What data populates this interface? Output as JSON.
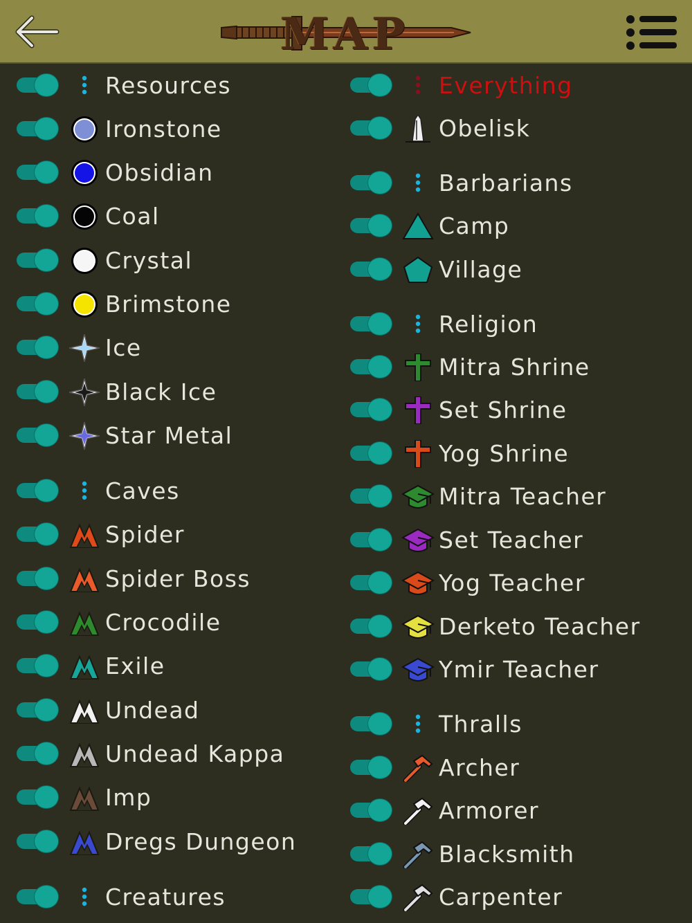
{
  "header": {
    "title": "MAP",
    "back": "back-arrow-icon",
    "menu": "menu-list-icon"
  },
  "colors": {
    "header": "#8e8a45",
    "background": "#2d2d20",
    "toggle": "#13a596",
    "text": "#e6e6dc",
    "highlight": "#cc1010"
  },
  "left": [
    {
      "label": "Resources",
      "icon": "dots"
    },
    {
      "label": "Ironstone",
      "icon": "circle",
      "color": "#7f8fd6"
    },
    {
      "label": "Obsidian",
      "icon": "circle",
      "color": "#1414e6"
    },
    {
      "label": "Coal",
      "icon": "circle",
      "color": "#050505"
    },
    {
      "label": "Crystal",
      "icon": "circle",
      "color": "#f6f6f6"
    },
    {
      "label": "Brimstone",
      "icon": "circle",
      "color": "#f4e400"
    },
    {
      "label": "Ice",
      "icon": "star",
      "color": "#a8d8f8"
    },
    {
      "label": "Black Ice",
      "icon": "star",
      "color": "#1a1a1a"
    },
    {
      "label": "Star Metal",
      "icon": "star",
      "color": "#6a6ae0"
    },
    {
      "label": "Caves",
      "icon": "dots"
    },
    {
      "label": "Spider",
      "icon": "cave",
      "color": "#e04a1a"
    },
    {
      "label": "Spider Boss",
      "icon": "cave",
      "color": "#ea5a2a"
    },
    {
      "label": "Crocodile",
      "icon": "cave",
      "color": "#2e8a2e"
    },
    {
      "label": "Exile",
      "icon": "cave",
      "color": "#16a69a"
    },
    {
      "label": "Undead",
      "icon": "cave",
      "color": "#f2f2f2"
    },
    {
      "label": "Undead Kappa",
      "icon": "cave",
      "color": "#b8b8b8"
    },
    {
      "label": "Imp",
      "icon": "cave",
      "color": "#6a4a38"
    },
    {
      "label": "Dregs Dungeon",
      "icon": "cave",
      "color": "#3a4ad0"
    },
    {
      "label": "Creatures",
      "icon": "dots"
    }
  ],
  "right": [
    {
      "label": "Everything",
      "icon": "dots-red"
    },
    {
      "label": "Obelisk",
      "icon": "obelisk"
    },
    {
      "label": "Barbarians",
      "icon": "dots"
    },
    {
      "label": "Camp",
      "icon": "triangle",
      "color": "#12a090"
    },
    {
      "label": "Village",
      "icon": "pentagon",
      "color": "#12a090"
    },
    {
      "label": "Religion",
      "icon": "dots"
    },
    {
      "label": "Mitra Shrine",
      "icon": "cross",
      "color": "#2e8a2e"
    },
    {
      "label": "Set Shrine",
      "icon": "cross",
      "color": "#9a2ac0"
    },
    {
      "label": "Yog Shrine",
      "icon": "cross",
      "color": "#d84a1a"
    },
    {
      "label": "Mitra Teacher",
      "icon": "cap",
      "color": "#2e8a2e"
    },
    {
      "label": "Set Teacher",
      "icon": "cap",
      "color": "#9a2ac0"
    },
    {
      "label": "Yog Teacher",
      "icon": "cap",
      "color": "#d84a1a"
    },
    {
      "label": "Derketo Teacher",
      "icon": "cap",
      "color": "#e4e040"
    },
    {
      "label": "Ymir Teacher",
      "icon": "cap",
      "color": "#3a4ad0"
    },
    {
      "label": "Thralls",
      "icon": "dots"
    },
    {
      "label": "Archer",
      "icon": "hammer",
      "color": "#e85a2a"
    },
    {
      "label": "Armorer",
      "icon": "hammer",
      "color": "#f2f2f2"
    },
    {
      "label": "Blacksmith",
      "icon": "hammer",
      "color": "#7a96b0"
    },
    {
      "label": "Carpenter",
      "icon": "hammer",
      "color": "#e0e0e0"
    }
  ]
}
